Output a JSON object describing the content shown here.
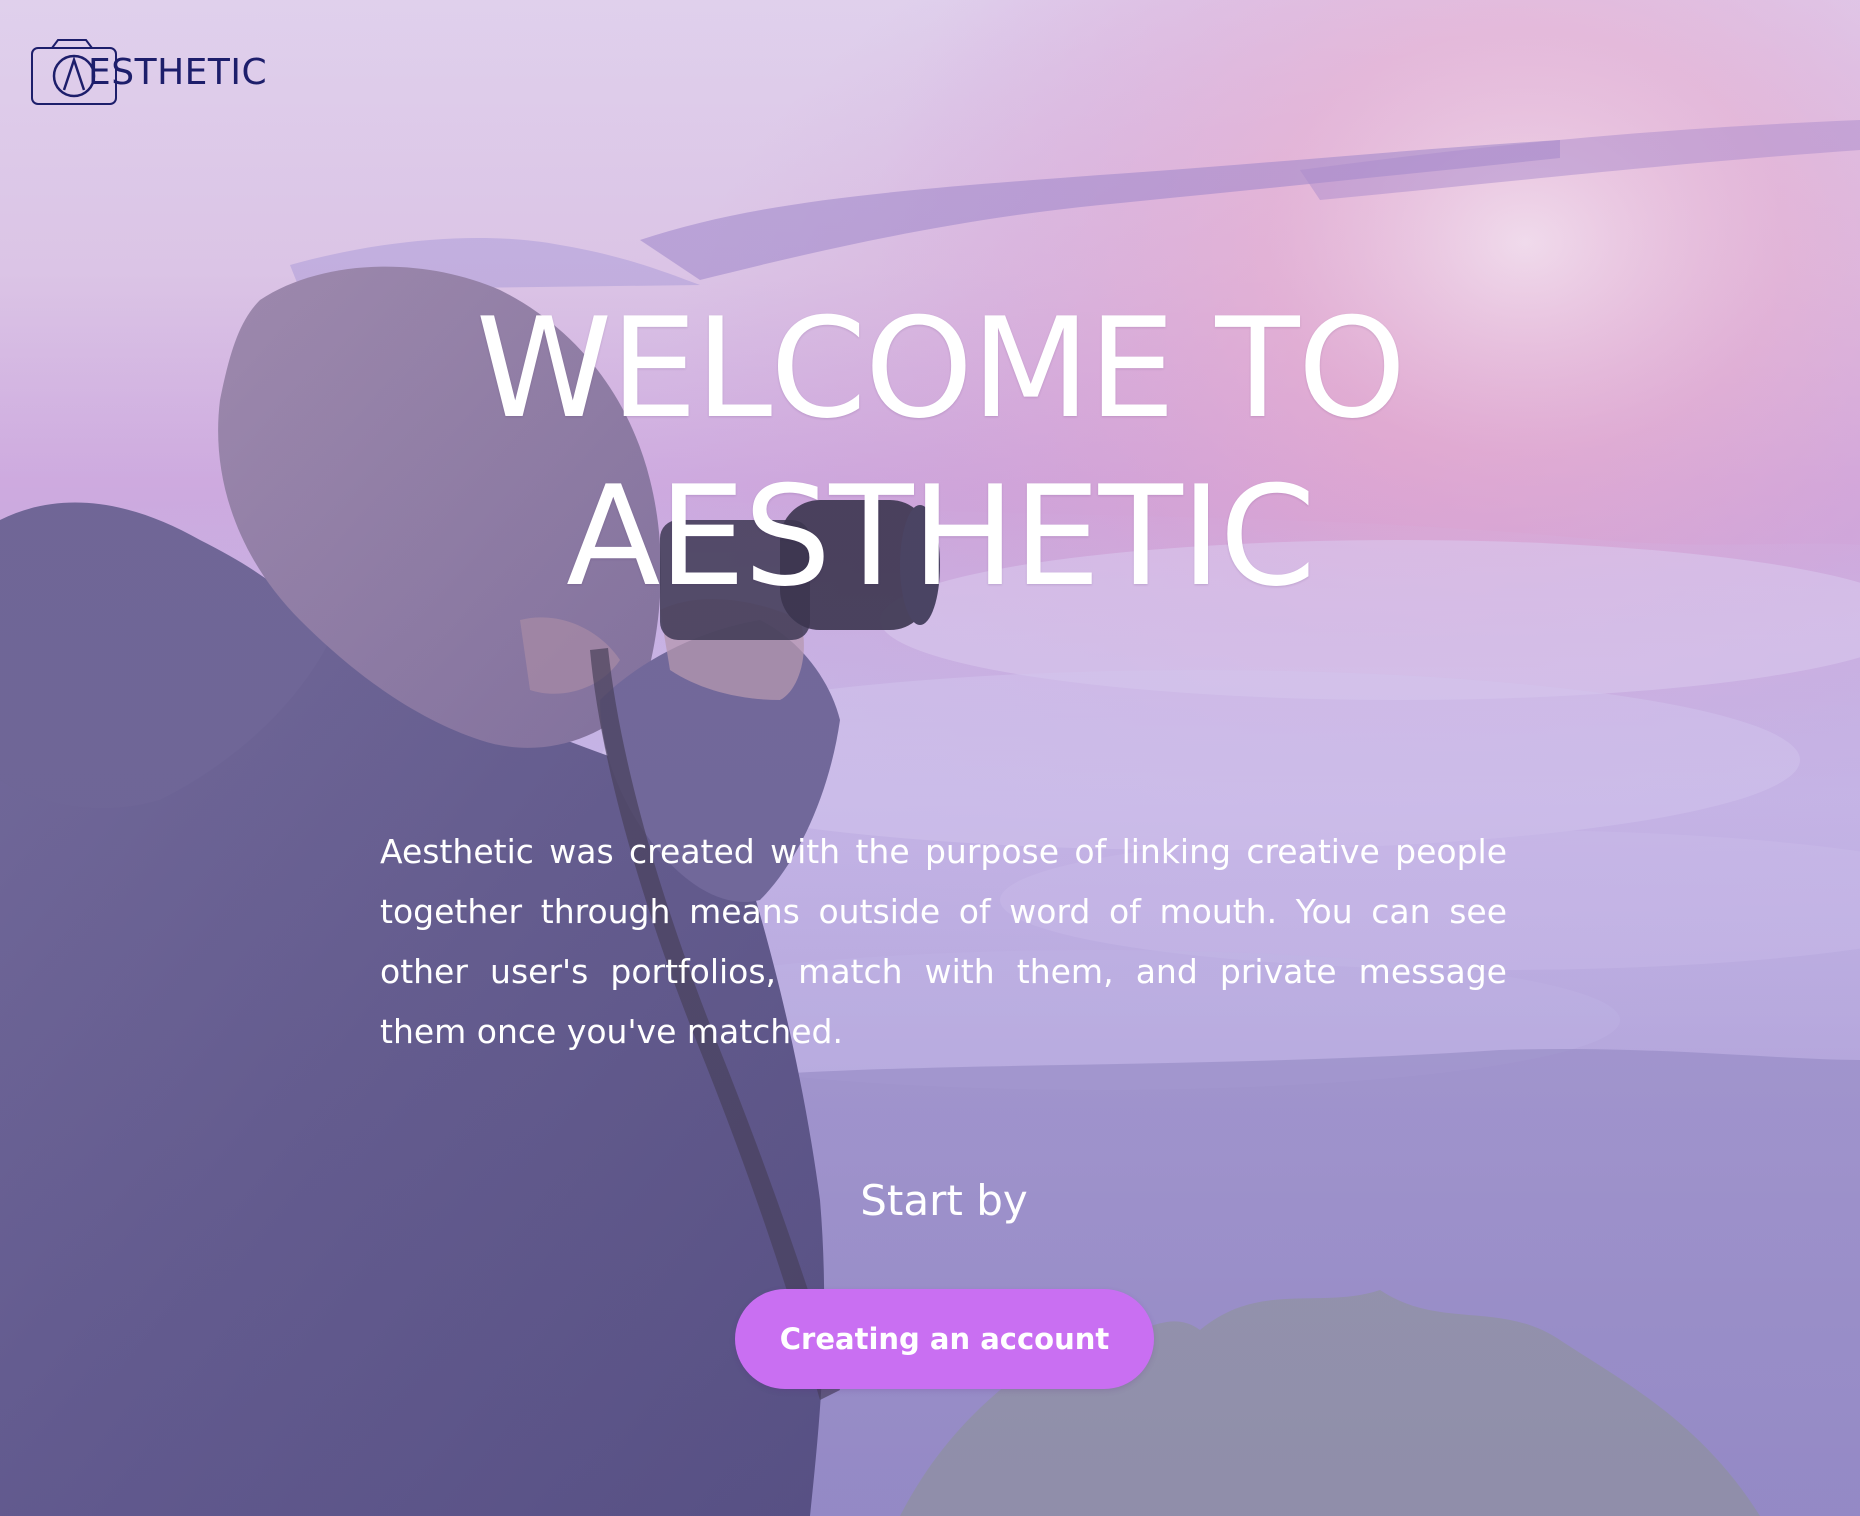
{
  "brand": {
    "logo_text": "ESTHETIC"
  },
  "hero": {
    "headline_line1": "WELCOME TO",
    "headline_line2": "AESTHETIC",
    "intro": "Aesthetic was created with the purpose of linking creative people together through means outside of word of mouth. You can see other user's portfolios, match with them, and private message them once you've matched.",
    "start_label": "Start by",
    "cta_label": "Creating an account"
  },
  "colors": {
    "logo": "#1d1e6b",
    "cta_background": "#c96ff2",
    "text": "#ffffff",
    "overlay": "#b9a6d8"
  }
}
